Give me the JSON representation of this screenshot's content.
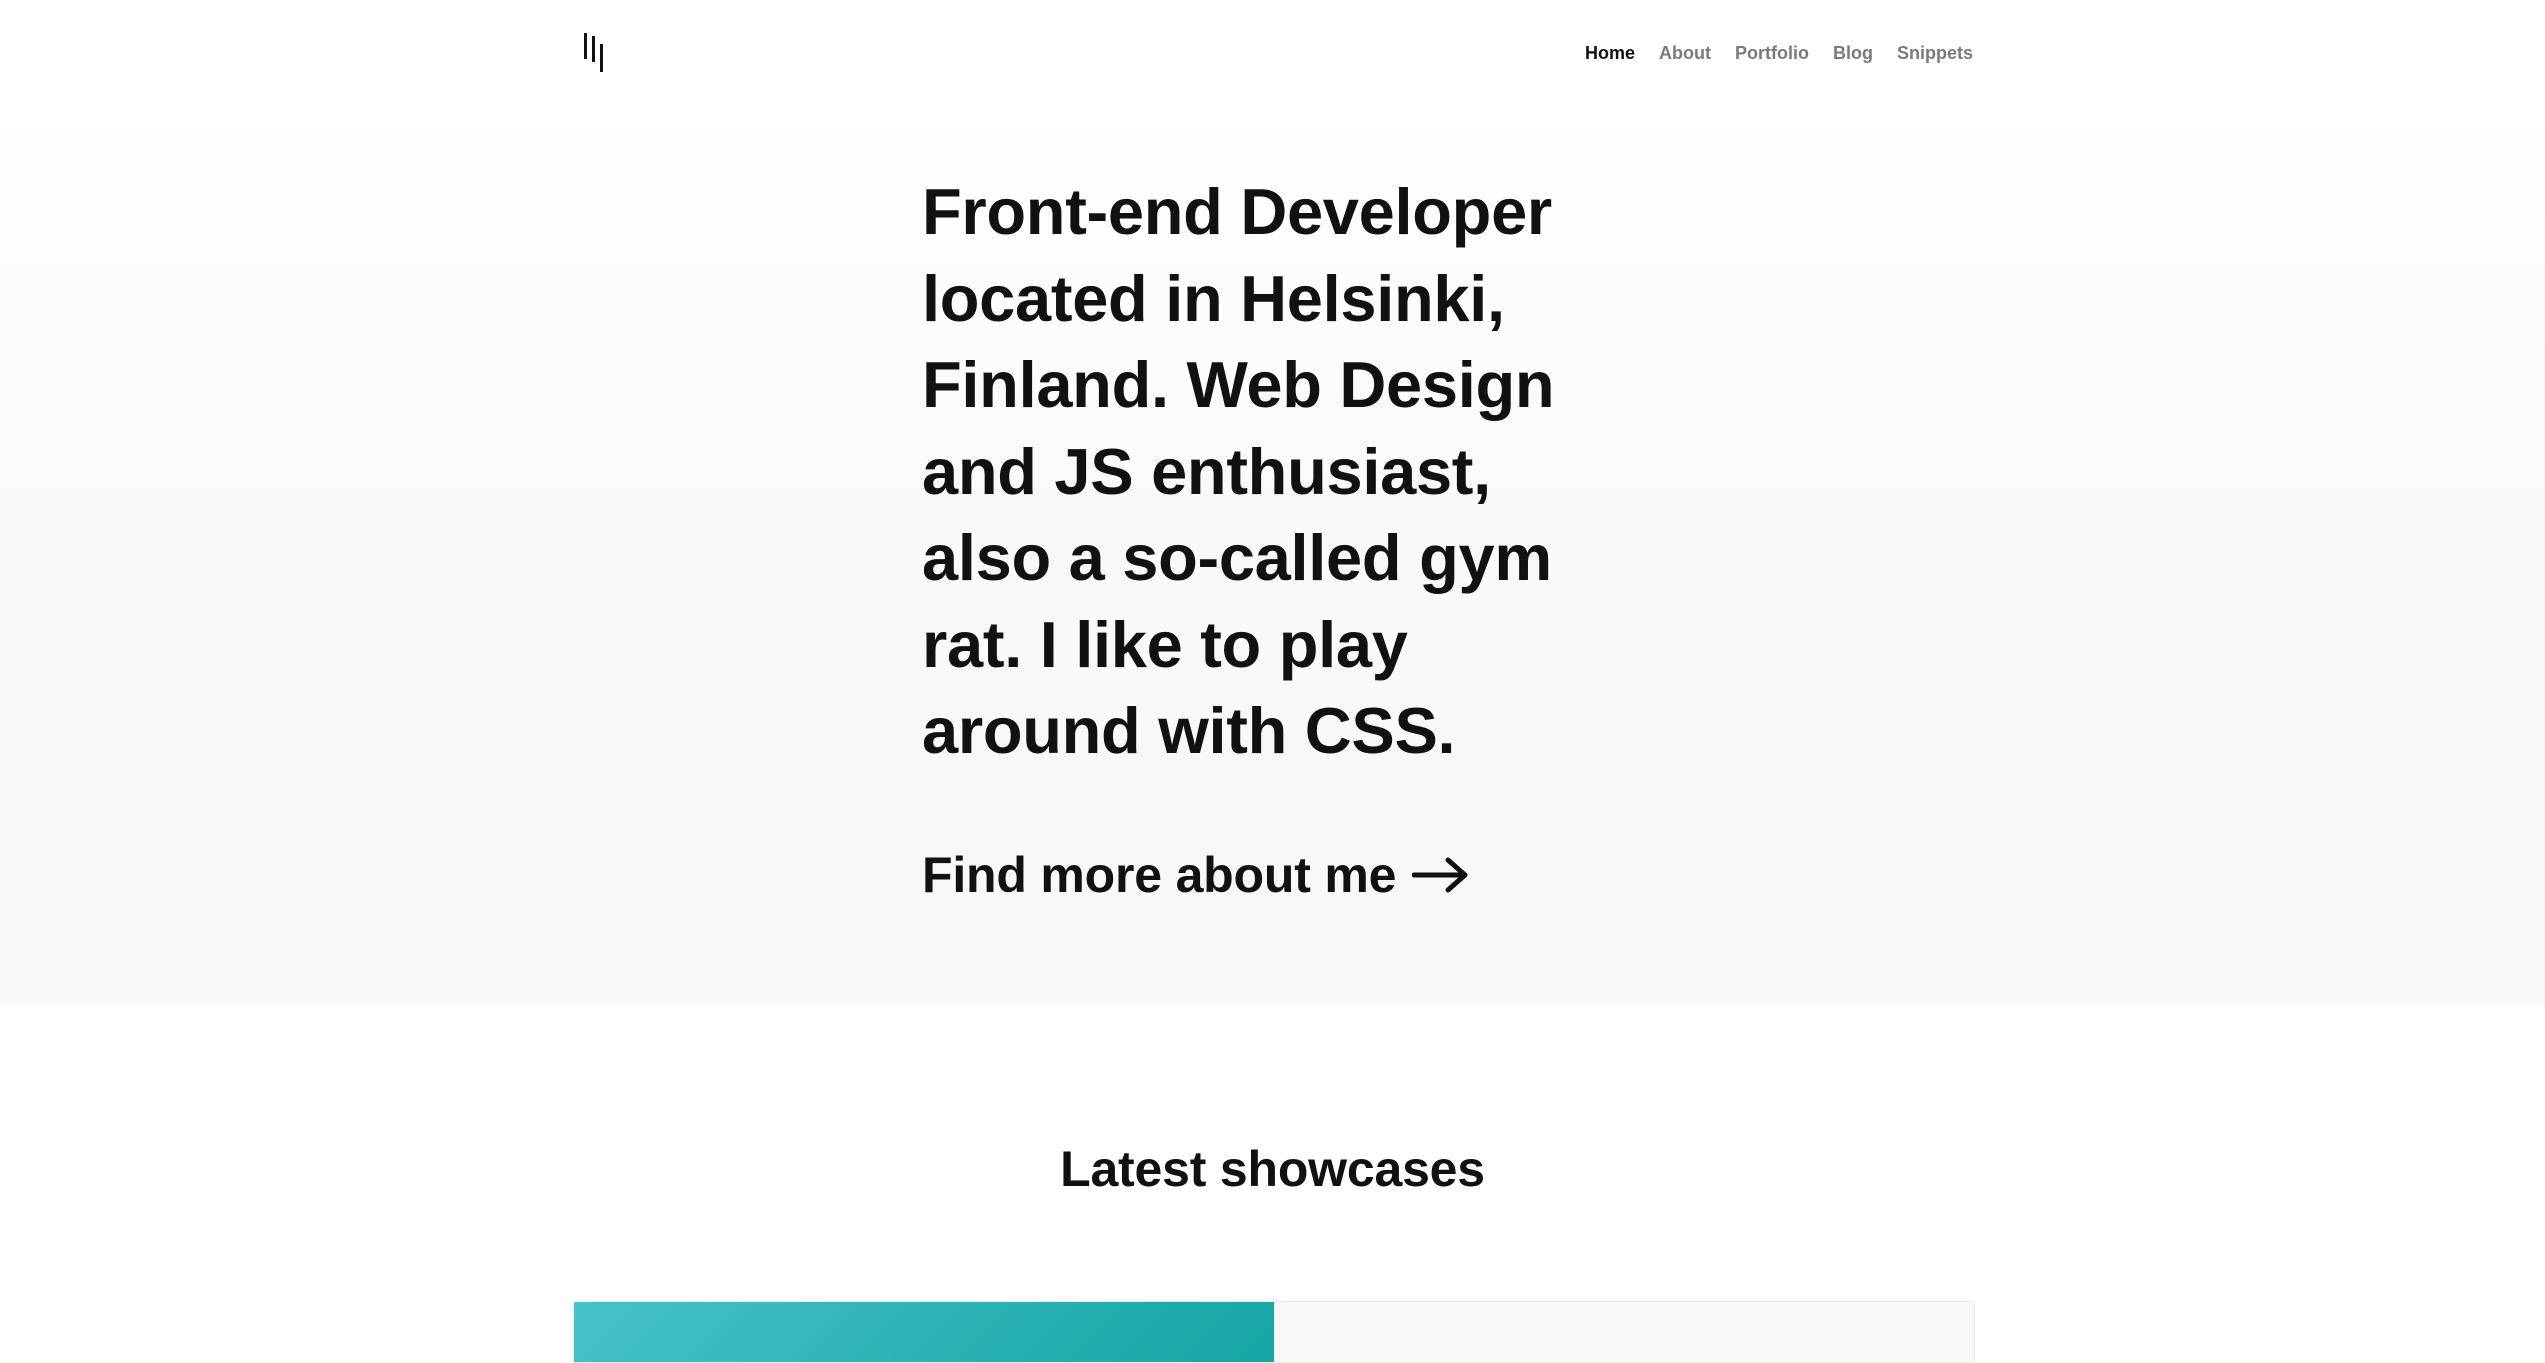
{
  "header": {
    "logo_name": "logo-bars-icon",
    "nav": [
      {
        "label": "Home",
        "active": true
      },
      {
        "label": "About",
        "active": false
      },
      {
        "label": "Portfolio",
        "active": false
      },
      {
        "label": "Blog",
        "active": false
      },
      {
        "label": "Snippets",
        "active": false
      }
    ]
  },
  "hero": {
    "heading": "Front-end Developer located in Helsinki, Finland. Web Design and JS enthusiast, also a so-called gym rat. I like to play around with CSS.",
    "cta_label": "Find more about me",
    "cta_icon": "arrow-right-icon"
  },
  "showcases": {
    "title": "Latest showcases",
    "card_accent": "#2db3b5"
  },
  "colors": {
    "text": "#111111",
    "nav_inactive": "#7a7a7a",
    "hero_bg": "#f8f8f8",
    "accent_teal": "#15a6a4"
  }
}
